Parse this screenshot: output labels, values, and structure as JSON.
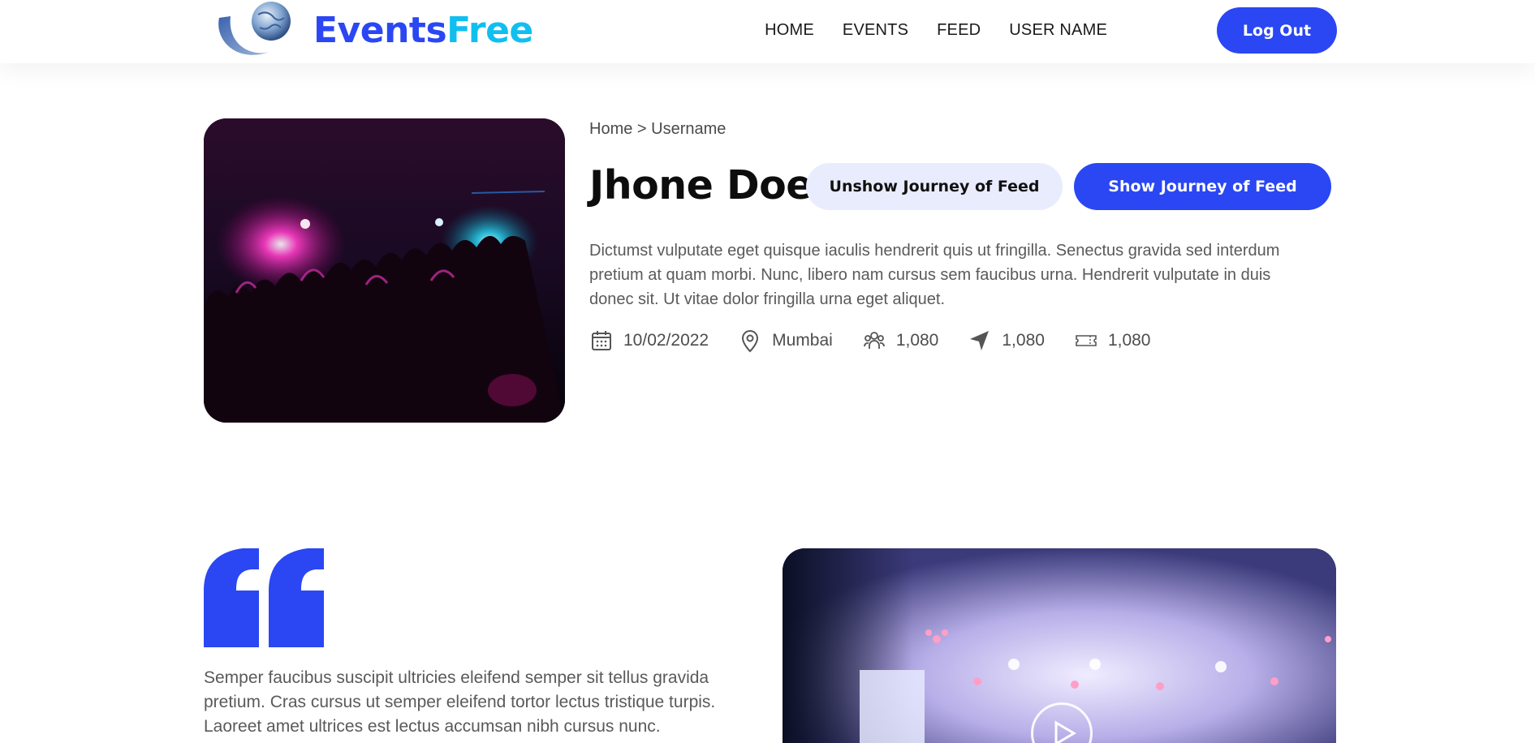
{
  "brand": {
    "part1": "Events",
    "part2": "Free"
  },
  "nav": {
    "items": [
      "HOME",
      "EVENTS",
      "FEED",
      "USER NAME"
    ],
    "logout": "Log Out"
  },
  "profile": {
    "breadcrumb": "Home > Username",
    "name": "Jhone Doe",
    "unshow_button": "Unshow Journey of Feed",
    "show_button": "Show Journey of Feed",
    "description": "Dictumst vulputate eget quisque iaculis hendrerit quis ut fringilla. Senectus gravida sed interdum pretium at quam morbi. Nunc, libero nam cursus sem faucibus urna. Hendrerit vulputate in duis donec sit. Ut vitae dolor fringilla urna eget aliquet.",
    "meta": {
      "date": "10/02/2022",
      "location": "Mumbai",
      "attendees": "1,080",
      "shares": "1,080",
      "tickets": "1,080"
    }
  },
  "quote": {
    "text": "Semper faucibus suscipit ultricies eleifend semper sit tellus gravida pretium. Cras cursus ut semper eleifend tortor lectus tristique turpis. Laoreet amet ultrices est lectus accumsan nibh cursus nunc."
  },
  "colors": {
    "primary": "#2a47f3",
    "accent": "#10bff0",
    "soft": "#e9ecfd"
  }
}
